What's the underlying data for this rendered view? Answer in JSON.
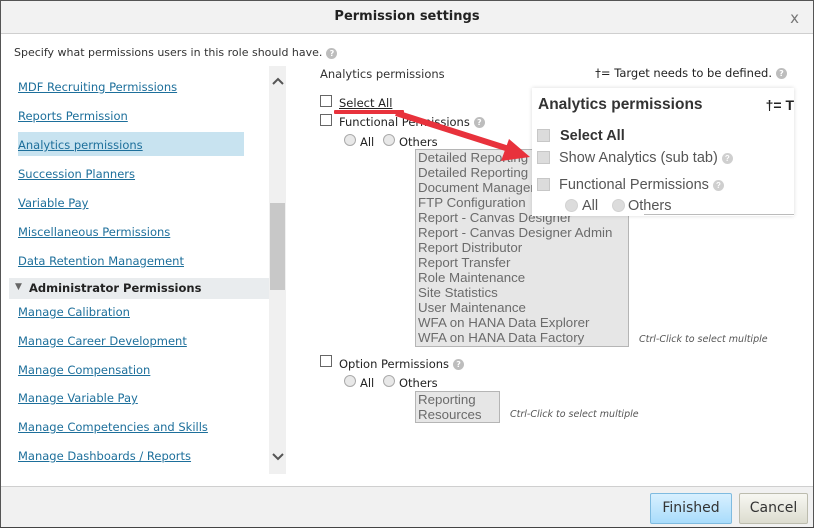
{
  "dialog": {
    "title": "Permission settings",
    "close_label": "x",
    "intro": "Specify what permissions users in this role should have."
  },
  "sidebar": {
    "items": [
      {
        "label": "MDF Recruiting Permissions"
      },
      {
        "label": "Reports Permission"
      },
      {
        "label": "Analytics permissions",
        "active": true
      },
      {
        "label": "Succession Planners"
      },
      {
        "label": "Variable Pay"
      },
      {
        "label": "Miscellaneous Permissions"
      },
      {
        "label": "Data Retention Management"
      }
    ],
    "section": {
      "label": "Administrator Permissions",
      "expanded": true
    },
    "admin_items": [
      {
        "label": "Manage Calibration"
      },
      {
        "label": "Manage Career Development"
      },
      {
        "label": "Manage Compensation"
      },
      {
        "label": "Manage Variable Pay"
      },
      {
        "label": "Manage Competencies and Skills"
      },
      {
        "label": "Manage Dashboards / Reports"
      }
    ],
    "scroll_up_icon": "^",
    "scroll_down_icon": "v"
  },
  "main": {
    "section_title": "Analytics permissions",
    "target_note": "†= Target needs to be defined.",
    "select_all": {
      "label": "Select All",
      "checked": false
    },
    "functional": {
      "label": "Functional Permissions",
      "radio_all": "All",
      "radio_others": "Others",
      "options": [
        "Detailed Reporting",
        "Detailed Reporting",
        "Document Management",
        "FTP Configuration",
        "Report - Canvas Designer",
        "Report - Canvas Designer Admin",
        "Report Distributor",
        "Report Transfer",
        "Role Maintenance",
        "Site Statistics",
        "User Maintenance",
        "WFA on HANA Data Explorer",
        "WFA on HANA Data Factory"
      ],
      "hint": "Ctrl-Click to select multiple"
    },
    "option": {
      "label": "Option Permissions",
      "radio_all": "All",
      "radio_others": "Others",
      "options": [
        "Reporting",
        "Resources"
      ],
      "hint": "Ctrl-Click to select multiple"
    }
  },
  "callout": {
    "title": "Analytics permissions",
    "note": "†= T",
    "select_all": "Select All",
    "show_analytics": "Show Analytics (sub tab)",
    "functional": "Functional Permissions",
    "radio_all": "All",
    "radio_others": "Others",
    "arrow_color": "#e8323c"
  },
  "footer": {
    "finished_label": "Finished",
    "cancel_label": "Cancel"
  }
}
